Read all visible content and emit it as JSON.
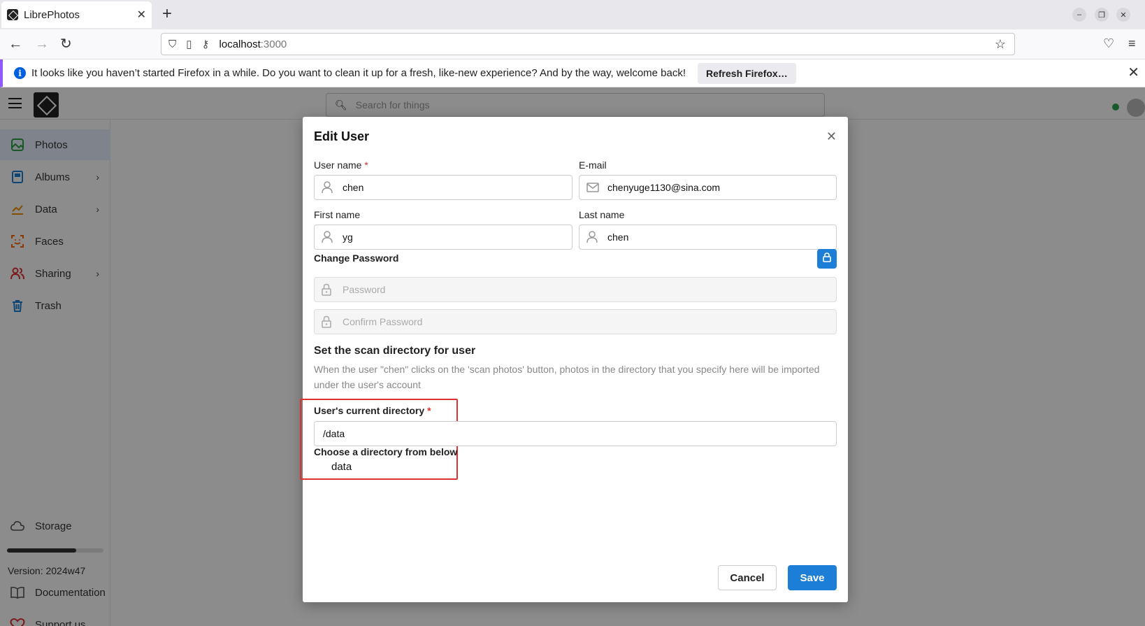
{
  "browser": {
    "tab_title": "LibrePhotos",
    "tab_close": "✕",
    "new_tab": "+",
    "url_host": "localhost",
    "url_port": ":3000",
    "notification": "It looks like you haven’t started Firefox in a while. Do you want to clean it up for a fresh, like-new experience? And by the way, welcome back!",
    "refresh_button": "Refresh Firefox…"
  },
  "app": {
    "search_placeholder": "Search for things",
    "sidebar": {
      "items": [
        {
          "label": "Photos",
          "icon": "photo-icon",
          "color": "#2f9e44"
        },
        {
          "label": "Albums",
          "icon": "album-icon",
          "color": "#1c7ed6"
        },
        {
          "label": "Data",
          "icon": "chart-icon",
          "color": "#f08c00"
        },
        {
          "label": "Faces",
          "icon": "face-scan-icon",
          "color": "#f76707"
        },
        {
          "label": "Sharing",
          "icon": "users-icon",
          "color": "#e03131"
        },
        {
          "label": "Trash",
          "icon": "trash-icon",
          "color": "#1c7ed6"
        }
      ],
      "storage": "Storage",
      "storage_used_fraction": 0.72,
      "version": "Version: 2024w47",
      "documentation": "Documentation",
      "support": "Support us"
    }
  },
  "modal": {
    "title": "Edit User",
    "username_label": "User name",
    "username_value": "chen",
    "email_label": "E-mail",
    "email_value": "chenyuge1130@sina.com",
    "firstname_label": "First name",
    "firstname_value": "yg",
    "lastname_label": "Last name",
    "lastname_value": "chen",
    "change_password": "Change Password",
    "password_placeholder": "Password",
    "confirm_placeholder": "Confirm Password",
    "scan_heading": "Set the scan directory for user",
    "scan_desc": "When the user \"chen\" clicks on the 'scan photos' button, photos in the directory that you specify here will be imported under the user's account",
    "current_dir_label": "User's current directory",
    "current_dir_value": "/data",
    "choose_dir_label": "Choose a directory from below",
    "dir_option": "data",
    "cancel": "Cancel",
    "save": "Save",
    "required_mark": "*",
    "accent_color": "#1c7ed6",
    "highlight_color": "#e03131"
  }
}
